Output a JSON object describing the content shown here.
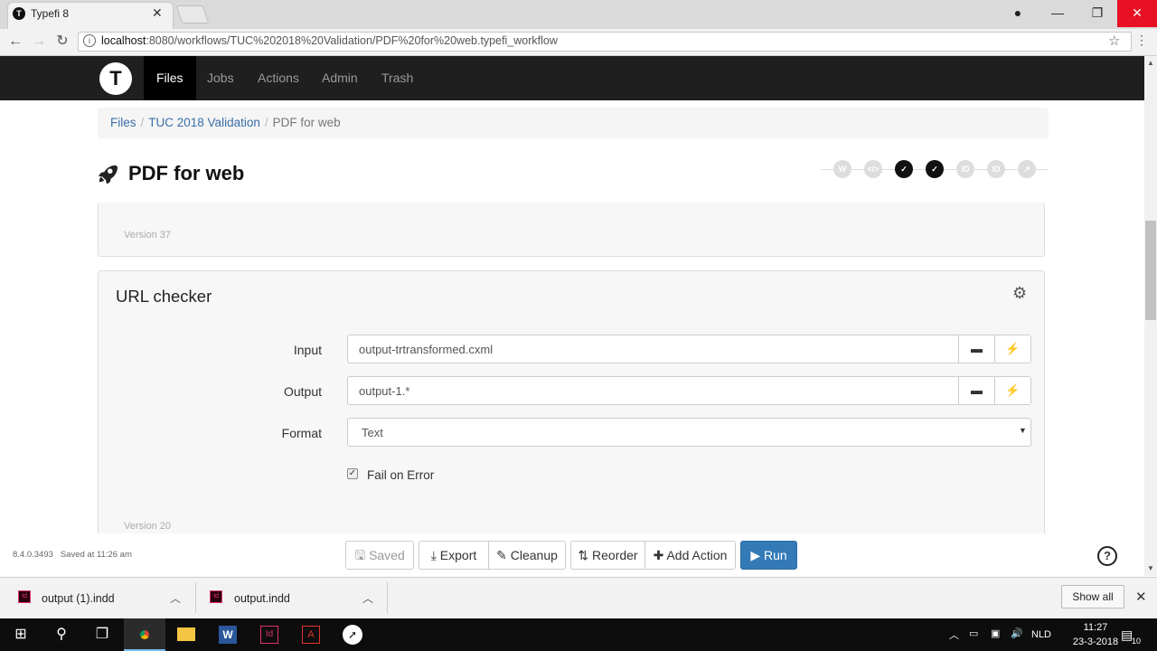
{
  "browser": {
    "tab_title": "Typefi 8",
    "tab_favicon": "T",
    "url_host": "localhost",
    "url_rest": ":8080/workflows/TUC%202018%20Validation/PDF%20for%20web.typefi_workflow"
  },
  "app": {
    "logo": "T",
    "nav": [
      "Files",
      "Jobs",
      "Actions",
      "Admin",
      "Trash"
    ],
    "active_nav": "Files"
  },
  "breadcrumb": [
    "Files",
    "TUC 2018 Validation",
    "PDF for web"
  ],
  "page_title": "PDF for web",
  "pipeline": [
    "W",
    "</>",
    "✓",
    "✓",
    "ID",
    "ID",
    "↗"
  ],
  "prev_panel": {
    "version": "Version 37"
  },
  "action_panel": {
    "title": "URL checker",
    "fields": {
      "input_label": "Input",
      "input_value": "output-trtransformed.cxml",
      "output_label": "Output",
      "output_value": "output-1.*",
      "format_label": "Format",
      "format_value": "Text"
    },
    "fail_on_error_label": "Fail on Error",
    "fail_on_error_checked": true,
    "version": "Version 20"
  },
  "footer": {
    "build": "8.4.0.3493",
    "saved_status": "Saved at 11:26 am",
    "buttons": {
      "saved": "Saved",
      "export": "Export",
      "cleanup": "Cleanup",
      "reorder": "Reorder",
      "add_action": "Add Action",
      "run": "Run"
    },
    "help": "?"
  },
  "downloads": {
    "items": [
      "output (1).indd",
      "output.indd"
    ],
    "icon_label": "Id",
    "show_all": "Show all"
  },
  "taskbar": {
    "lang": "NLD",
    "time": "11:27",
    "date": "23-3-2018",
    "notifications": "10"
  },
  "colors": {
    "accent": "#337ab7",
    "nav_bg": "#1f1f1f",
    "link": "#3a6fa8"
  }
}
